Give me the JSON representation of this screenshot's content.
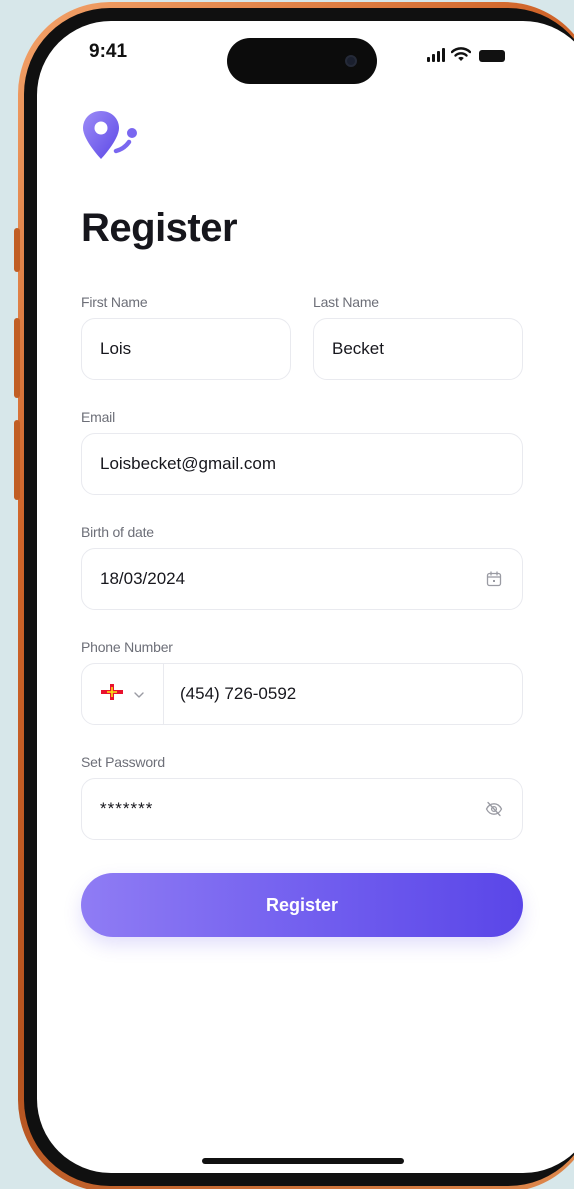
{
  "status_bar": {
    "time": "9:41"
  },
  "app": {
    "logo_icon": "location-pin-logo",
    "brand_color": "#7b68f0"
  },
  "form": {
    "title": "Register",
    "first_name": {
      "label": "First Name",
      "value": "Lois"
    },
    "last_name": {
      "label": "Last Name",
      "value": "Becket"
    },
    "email": {
      "label": "Email",
      "value": "Loisbecket@gmail.com"
    },
    "birth_date": {
      "label": "Birth of date",
      "value": "18/03/2024",
      "icon": "calendar-icon"
    },
    "phone": {
      "label": "Phone Number",
      "country_flag": "guernsey-flag",
      "value": "(454) 726-0592"
    },
    "password": {
      "label": "Set Password",
      "value": "*******",
      "icon": "eye-off-icon"
    },
    "submit_label": "Register"
  }
}
